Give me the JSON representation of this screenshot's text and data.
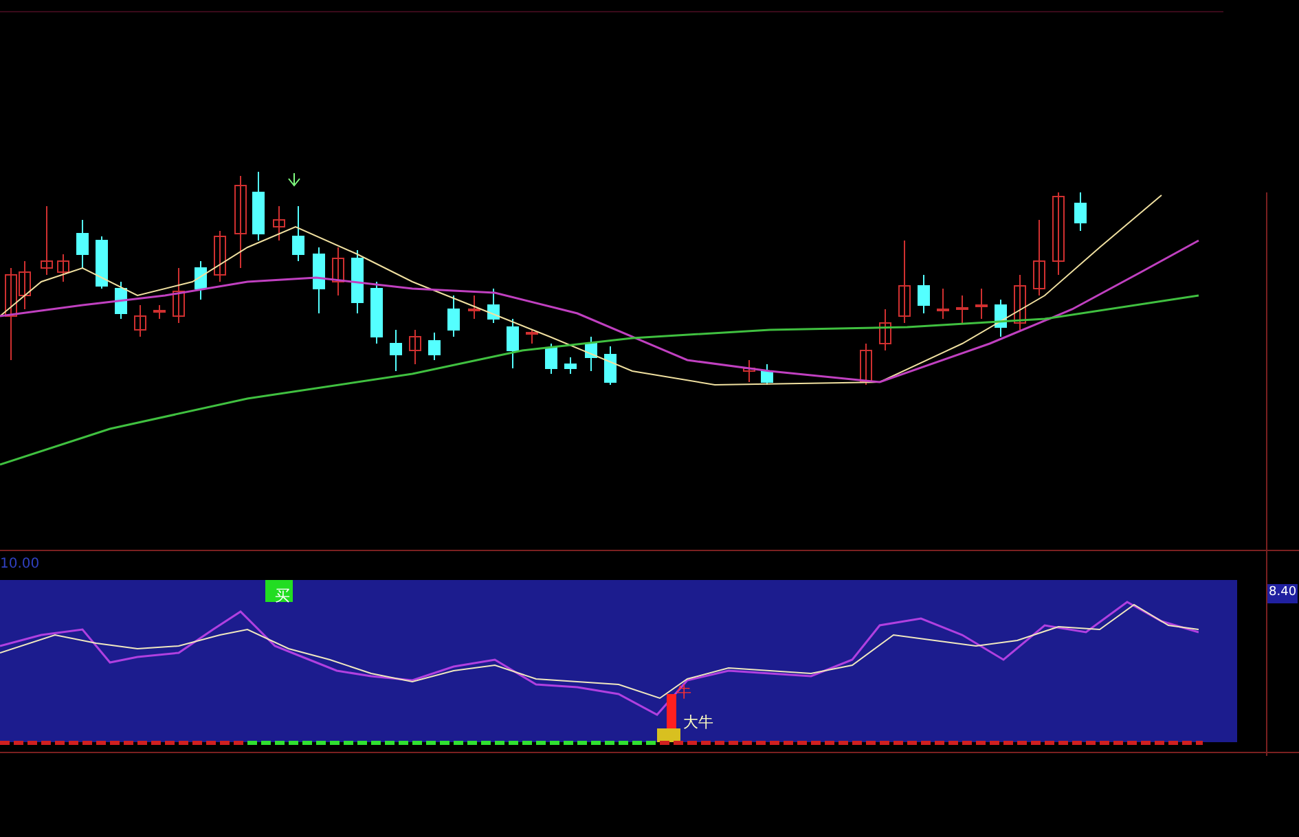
{
  "indicator_panel": {
    "top_value": "10.00",
    "right_value": "8.40",
    "signals": [
      {
        "kind": "buy",
        "label": "买"
      },
      {
        "kind": "bull",
        "label": "牛"
      },
      {
        "kind": "big_bull",
        "label": "大牛"
      }
    ]
  }
}
